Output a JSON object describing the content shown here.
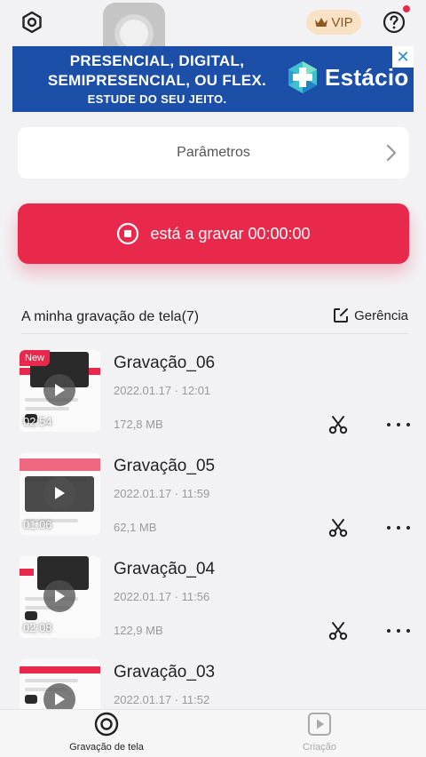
{
  "header": {
    "vip_label": "VIP"
  },
  "ad": {
    "line1": "PRESENCIAL, DIGITAL,",
    "line2": "SEMIPRESENCIAL, OU FLEX.",
    "line3": "ESTUDE DO SEU JEITO.",
    "brand": "Estácio",
    "close_symbol": "✕",
    "colors": {
      "background": "#1c4fa8"
    }
  },
  "params": {
    "label": "Parâmetros"
  },
  "record": {
    "label": "está a gravar 00:00:00",
    "color": "#e8294c"
  },
  "section": {
    "title": "A minha gravação de tela(7)",
    "manage_label": "Gerência"
  },
  "recordings": [
    {
      "title": "Gravação_06",
      "date": "2022.01.17 · 12:01",
      "size": "172,8 MB",
      "duration": "02:54",
      "badge": "New"
    },
    {
      "title": "Gravação_05",
      "date": "2022.01.17 · 11:59",
      "size": "62,1 MB",
      "duration": "01:06"
    },
    {
      "title": "Gravação_04",
      "date": "2022.01.17 · 11:56",
      "size": "122,9 MB",
      "duration": "02:08"
    },
    {
      "title": "Gravação_03",
      "date": "2022.01.17 · 11:52"
    }
  ],
  "bottom_nav": {
    "items": [
      {
        "label": "Gravação de tela",
        "icon": "record-circle-icon",
        "active": true
      },
      {
        "label": "Criação",
        "icon": "video-play-icon",
        "active": false
      }
    ]
  }
}
